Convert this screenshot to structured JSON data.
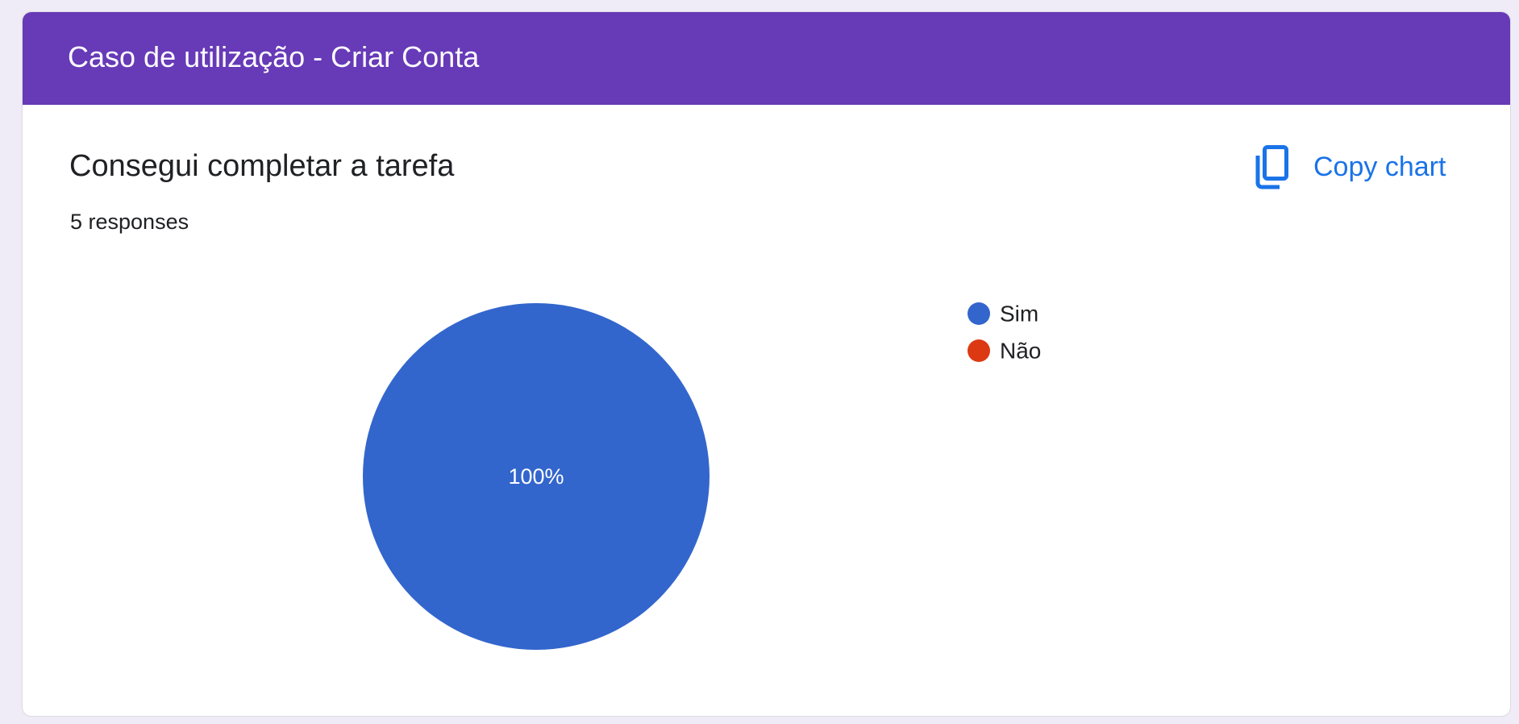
{
  "section": {
    "title": "Caso de utilização - Criar Conta"
  },
  "question": {
    "title": "Consegui completar a tarefa",
    "responses": "5 responses"
  },
  "actions": {
    "copy_chart_label": "Copy chart",
    "copy_chart_icon": "copy-icon"
  },
  "colors": {
    "header": "#673ab7",
    "accent": "#1a73e8"
  },
  "chart_data": {
    "type": "pie",
    "title": "",
    "legend_position": "right",
    "slices": [
      {
        "label": "Sim",
        "value": 100,
        "display": "100%",
        "color": "#3366cc"
      },
      {
        "label": "Não",
        "value": 0,
        "display": "",
        "color": "#dc3912"
      }
    ]
  }
}
